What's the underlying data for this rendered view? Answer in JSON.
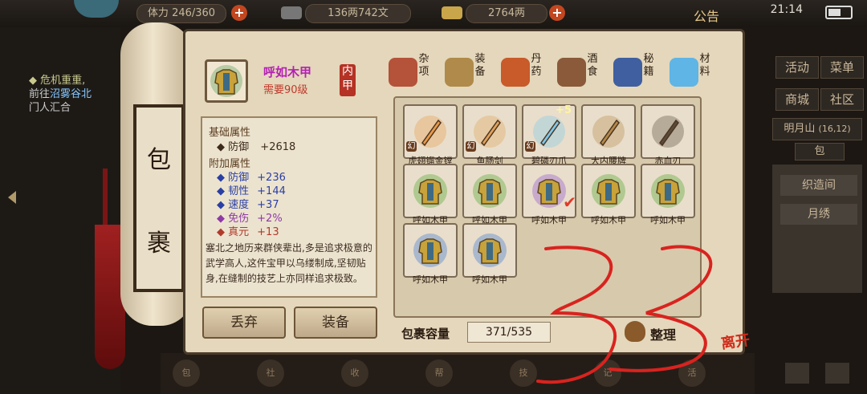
{
  "topbar": {
    "stat_partial": "体力",
    "stat_value": "246/360",
    "copper": "136两742文",
    "silver": "2764两",
    "notice": "公告",
    "time": "21:14"
  },
  "quest": {
    "title": "危机重重,",
    "line2_a": "前往",
    "line2_place": "沼雾谷北",
    "line3": "门人汇合"
  },
  "right_menu": {
    "activity": "活动",
    "menu": "菜单",
    "shop": "商城",
    "community": "社区",
    "location": "明月山",
    "coords": "(16,12)",
    "bag_tab": "包",
    "items": [
      "织造间",
      "月绣"
    ]
  },
  "scroll_title": [
    "包",
    "裹"
  ],
  "selected_item": {
    "name": "呼如木甲",
    "requirement": "需要90级",
    "slot": "内甲",
    "base_section": "基础属性",
    "base_attrs": [
      {
        "label": "防御",
        "value": "+2618"
      }
    ],
    "extra_section": "附加属性",
    "extra_attrs": [
      {
        "label": "防御",
        "value": "+236",
        "color": "#2b3fa3"
      },
      {
        "label": "韧性",
        "value": "+144",
        "color": "#2b3fa3"
      },
      {
        "label": "速度",
        "value": "+37",
        "color": "#2b3fa3"
      },
      {
        "label": "免伤",
        "value": "+2%",
        "color": "#8e3aa6"
      },
      {
        "label": "真元",
        "value": "+13",
        "color": "#b23a2a"
      }
    ],
    "description": "塞北之地历来群侠辈出,多是追求极意的武学高人,这件宝甲以乌缕制成,坚韧贴身,在缝制的技艺上亦同样追求极致。"
  },
  "buttons": {
    "discard": "丢弃",
    "equip": "装备",
    "sort": "整理",
    "leave": "离开"
  },
  "categories": [
    {
      "label": "杂项",
      "color": "#b5523a"
    },
    {
      "label": "装备",
      "color": "#b08a4a"
    },
    {
      "label": "丹药",
      "color": "#c95a2a"
    },
    {
      "label": "酒食",
      "color": "#8a5a3a"
    },
    {
      "label": "秘籍",
      "color": "#3f5fa0"
    },
    {
      "label": "材料",
      "color": "#5fb5e5"
    }
  ],
  "items": [
    {
      "name": "虎翅镏金镗",
      "tag": "幻",
      "plus": "",
      "color": "#e89a4a"
    },
    {
      "name": "鱼肠剑",
      "tag": "幻",
      "plus": "",
      "color": "#e0a25a"
    },
    {
      "name": "碧磷刃爪",
      "tag": "幻",
      "plus": "+5",
      "color": "#7ec8ea"
    },
    {
      "name": "大内腰牌",
      "tag": "",
      "plus": "",
      "color": "#b48a4a"
    },
    {
      "name": "赤血刃",
      "tag": "",
      "plus": "",
      "color": "#5a4a3a"
    },
    {
      "name": "呼如木甲",
      "tag": "",
      "plus": "",
      "color": "#c8a23a",
      "glow": "#6ab04a"
    },
    {
      "name": "呼如木甲",
      "tag": "",
      "plus": "",
      "color": "#c8a23a",
      "glow": "#6ab04a"
    },
    {
      "name": "呼如木甲",
      "tag": "",
      "plus": "",
      "color": "#c8a23a",
      "glow": "#a06ad0",
      "check": "✔"
    },
    {
      "name": "呼如木甲",
      "tag": "",
      "plus": "",
      "color": "#c8a23a",
      "glow": "#6ab04a"
    },
    {
      "name": "呼如木甲",
      "tag": "",
      "plus": "",
      "color": "#c8a23a",
      "glow": "#6ab04a"
    },
    {
      "name": "呼如木甲",
      "tag": "",
      "plus": "",
      "color": "#c8a23a",
      "glow": "#5a8ad0"
    },
    {
      "name": "呼如木甲",
      "tag": "",
      "plus": "",
      "color": "#c8a23a",
      "glow": "#5a8ad0"
    }
  ],
  "capacity": {
    "label": "包裹容量",
    "value": "371/535"
  },
  "bottom_nav": [
    "包",
    "社",
    "收",
    "帮",
    "技",
    "记",
    "活"
  ]
}
